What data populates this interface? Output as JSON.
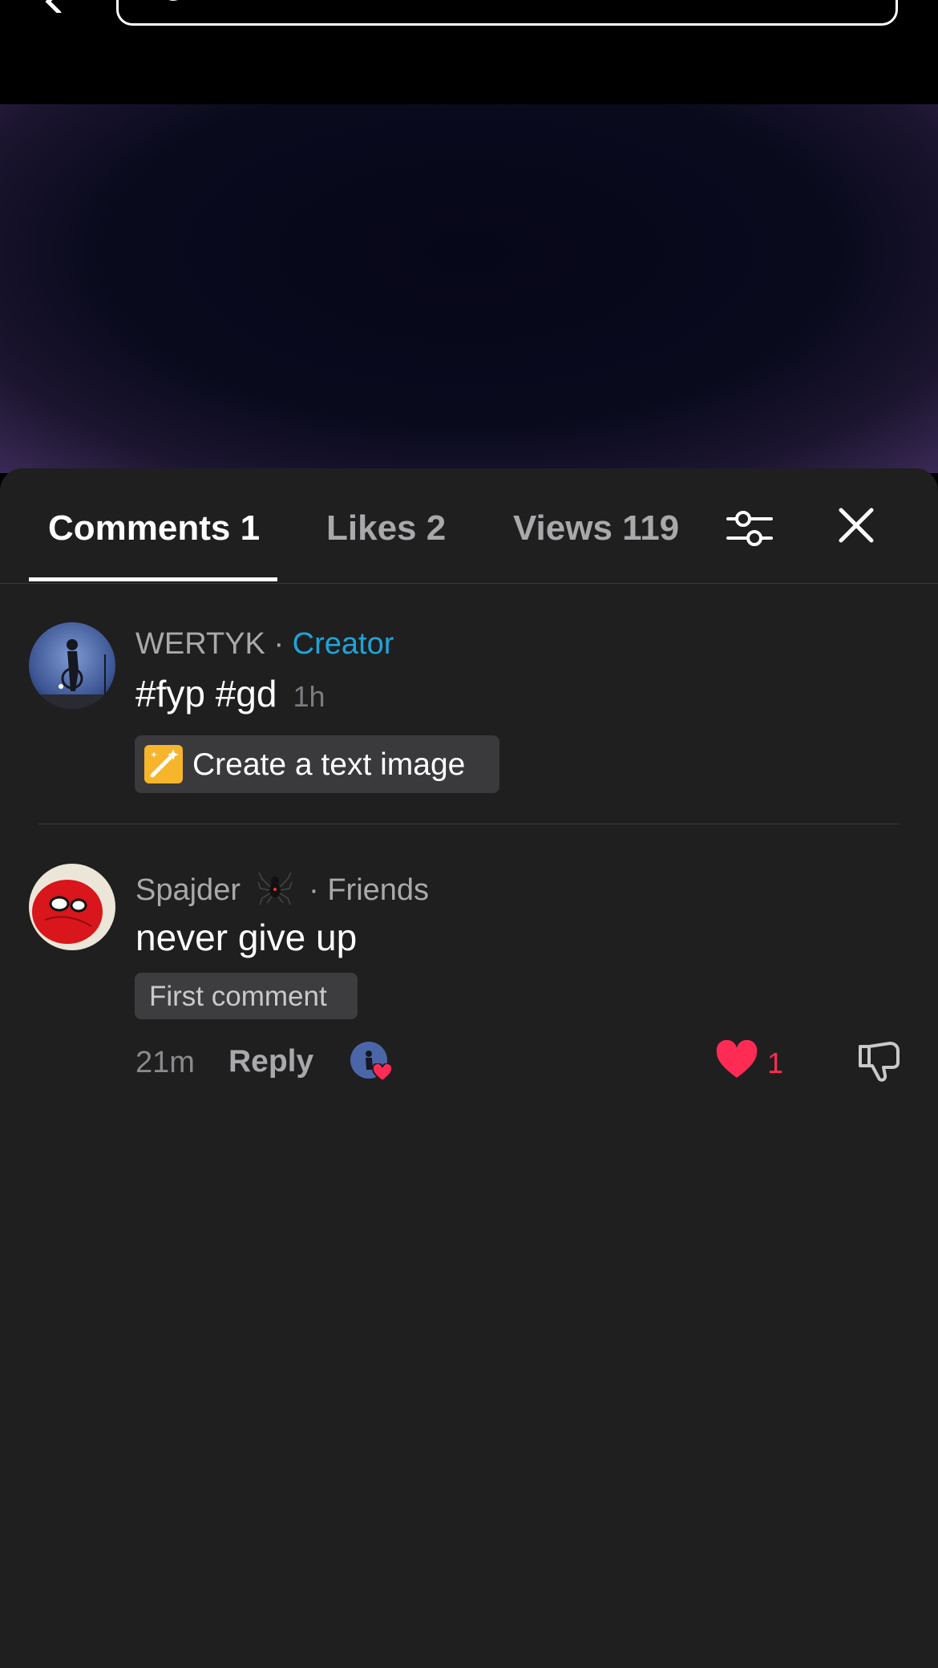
{
  "search": {
    "placeholder": ""
  },
  "tabs": [
    {
      "label": "Comments 1"
    },
    {
      "label": "Likes 2"
    },
    {
      "label": "Views 119"
    }
  ],
  "comments": [
    {
      "username": "WERTYK",
      "separator": "·",
      "tag": "Creator",
      "text": "#fyp #gd",
      "time": "1h",
      "action_pill": {
        "icon": "magic-wand-icon",
        "label": "Create a text image"
      }
    },
    {
      "username": "Spajder",
      "badge_icon": "spider-icon",
      "separator": "·",
      "tag": "Friends",
      "text": "never give up",
      "badge_label": "First comment",
      "time": "21m",
      "reply_label": "Reply",
      "like_count": "1"
    }
  ],
  "colors": {
    "accent_creator": "#1ea4d8",
    "like": "#fe2c55",
    "sheet_bg": "#1f1f20"
  }
}
